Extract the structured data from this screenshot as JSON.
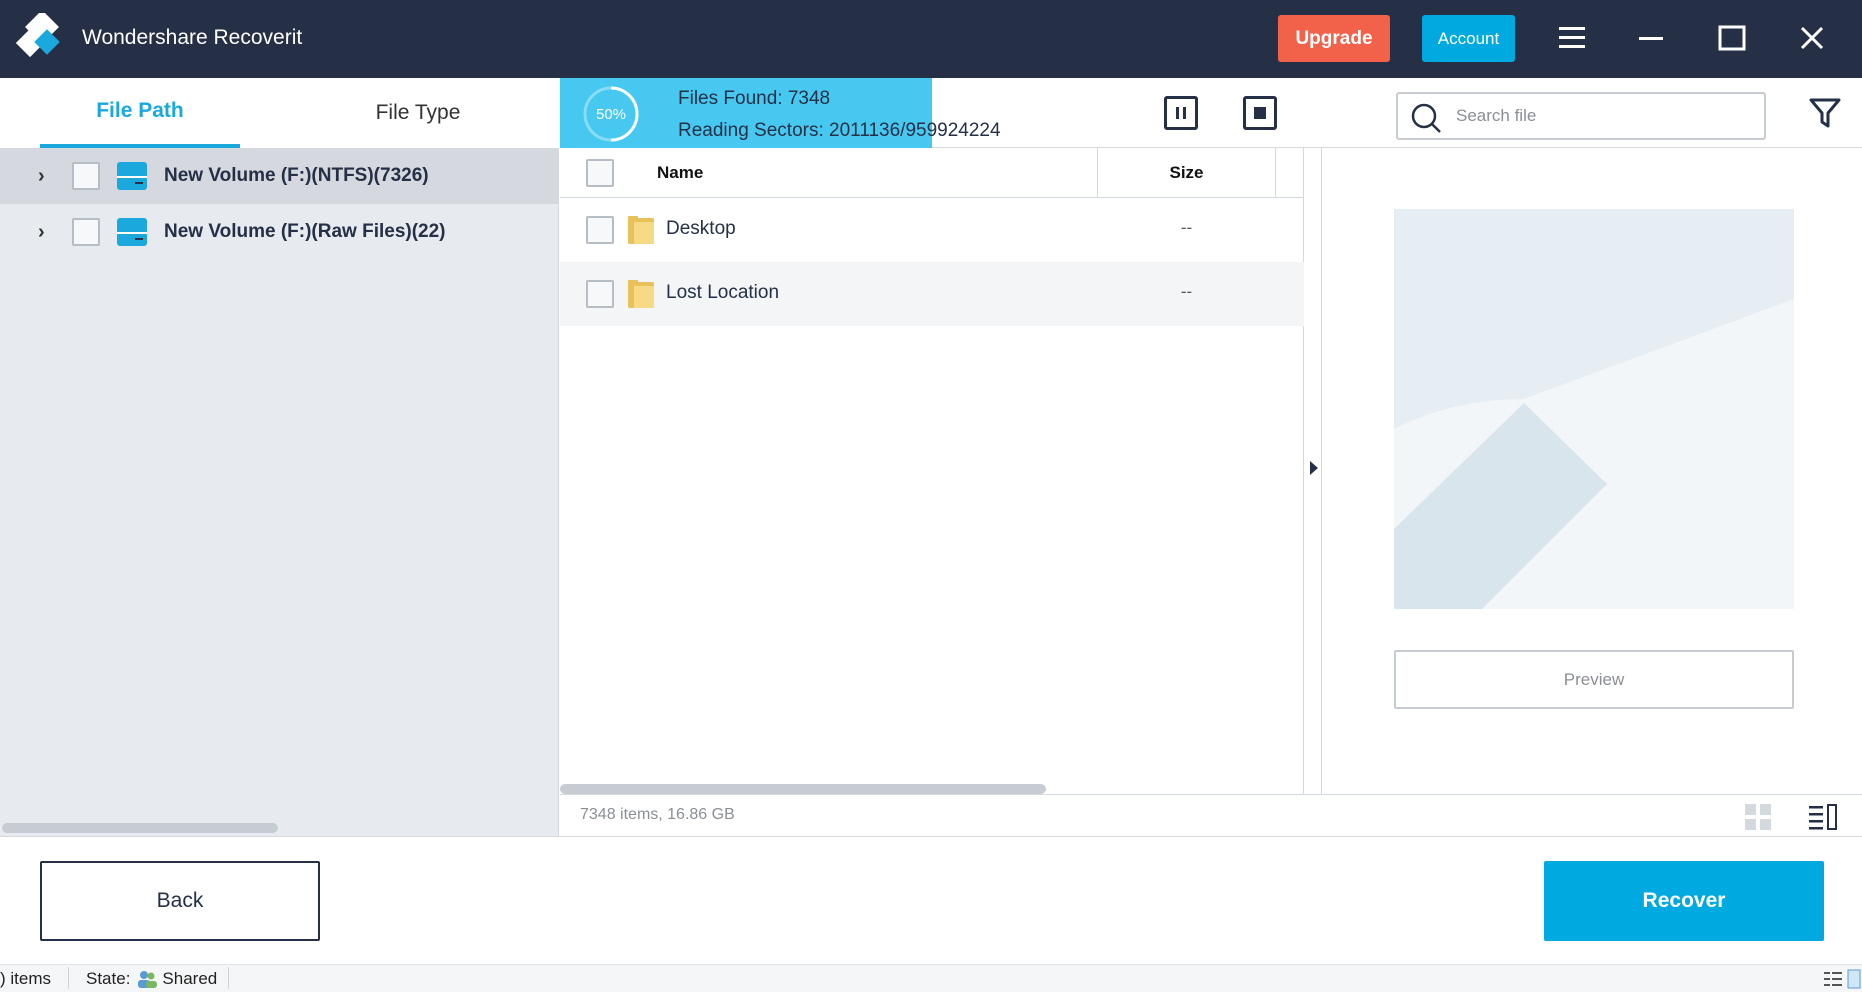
{
  "app": {
    "title": "Wondershare Recoverit",
    "upgrade_label": "Upgrade",
    "account_label": "Account",
    "colors": {
      "titlebar": "#253047",
      "upgrade": "#f2624a",
      "accent": "#00a9e0"
    }
  },
  "sidebar": {
    "tabs": [
      {
        "label": "File Path",
        "active": true
      },
      {
        "label": "File Type",
        "active": false
      }
    ],
    "items": [
      {
        "label": "New Volume (F:)(NTFS)(7326)",
        "selected": true
      },
      {
        "label": "New Volume (F:)(Raw Files)(22)",
        "selected": false
      }
    ]
  },
  "scan": {
    "percent_label": "50%",
    "progress": 0.5,
    "files_found": "Files Found:  7348",
    "reading_sectors": "Reading Sectors:  2011136/959924224"
  },
  "search": {
    "placeholder": "Search file"
  },
  "table": {
    "columns": {
      "name": "Name",
      "size": "Size"
    },
    "rows": [
      {
        "name": "Desktop",
        "size": "--"
      },
      {
        "name": "Lost Location",
        "size": "--"
      }
    ]
  },
  "preview": {
    "button_label": "Preview"
  },
  "stats": {
    "text": "7348 items, 16.86 GB"
  },
  "footer": {
    "back_label": "Back",
    "recover_label": "Recover"
  },
  "os_status": {
    "items": ") items",
    "state_label": "State:",
    "state_value": "Shared"
  },
  "icons": [
    "logo-icon",
    "menu-icon",
    "minimize-icon",
    "maximize-icon",
    "close-icon",
    "chevron-right-icon",
    "drive-icon",
    "pause-icon",
    "stop-icon",
    "search-icon",
    "filter-icon",
    "folder-icon",
    "grid-view-icon",
    "list-view-icon",
    "shared-icon"
  ]
}
